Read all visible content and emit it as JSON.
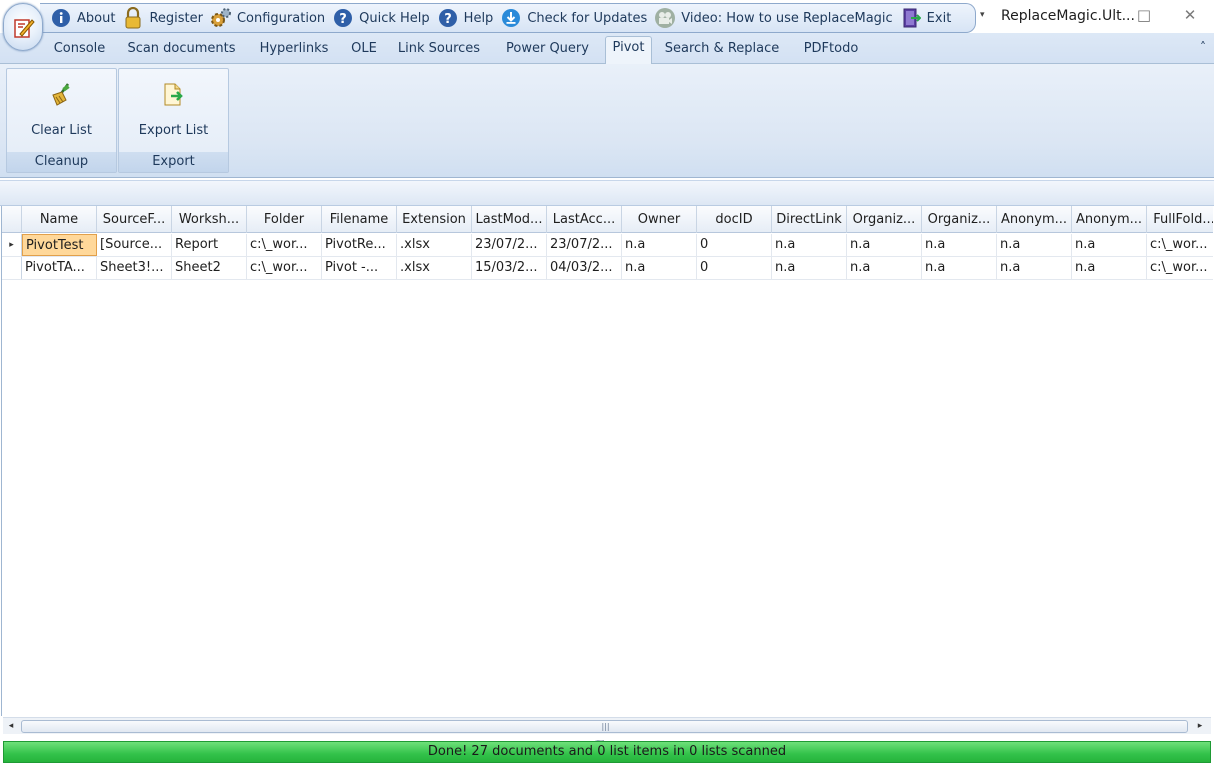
{
  "window": {
    "title": "ReplaceMagic.Ult...",
    "minimize_glyph": "□",
    "close_glyph": "✕"
  },
  "qat": {
    "items": [
      {
        "label": "About",
        "icon": "info-icon"
      },
      {
        "label": "Register",
        "icon": "lock-icon"
      },
      {
        "label": "Configuration",
        "icon": "gears-icon"
      },
      {
        "label": "Quick Help",
        "icon": "question-icon"
      },
      {
        "label": "Help",
        "icon": "question-icon"
      },
      {
        "label": "Check for Updates",
        "icon": "download-icon"
      },
      {
        "label": "Video: How to use ReplaceMagic",
        "icon": "video-icon"
      },
      {
        "label": "Exit",
        "icon": "exit-door-icon"
      }
    ],
    "more_glyph": "▾"
  },
  "tabs": [
    {
      "label": "Console"
    },
    {
      "label": "Scan documents"
    },
    {
      "label": "Hyperlinks"
    },
    {
      "label": "OLE"
    },
    {
      "label": "Link Sources"
    },
    {
      "label": "Power Query"
    },
    {
      "label": "Pivot",
      "active": true
    },
    {
      "label": "Search & Replace"
    },
    {
      "label": "PDFtodo"
    }
  ],
  "collapse_glyph": "˄",
  "ribbon": {
    "groups": [
      {
        "caption": "Cleanup",
        "button": "Clear List",
        "icon": "broom-icon"
      },
      {
        "caption": "Export",
        "button": "Export List",
        "icon": "export-icon"
      }
    ]
  },
  "grid": {
    "columns": [
      "Name",
      "SourceF...",
      "Worksh...",
      "Folder",
      "Filename",
      "Extension",
      "LastMod...",
      "LastAcc...",
      "Owner",
      "docID",
      "DirectLink",
      "Organiz...",
      "Organiz...",
      "Anonym...",
      "Anonym...",
      "FullFold..."
    ],
    "rows": [
      {
        "current": true,
        "cells": [
          "PivotTest",
          "[Source...",
          "Report",
          "c:\\_wor...",
          "PivotRe...",
          ".xlsx",
          "23/07/2...",
          "23/07/2...",
          "n.a",
          "0",
          "n.a",
          "n.a",
          "n.a",
          "n.a",
          "n.a",
          "c:\\_wor..."
        ]
      },
      {
        "current": false,
        "cells": [
          "PivotTA...",
          "Sheet3!...",
          "Sheet2",
          "c:\\_wor...",
          "Pivot -...",
          ".xlsx",
          "15/03/2...",
          "04/03/2...",
          "n.a",
          "0",
          "n.a",
          "n.a",
          "n.a",
          "n.a",
          "n.a",
          "c:\\_wor..."
        ]
      }
    ],
    "row_pointer_glyph": "▸"
  },
  "scrollbar": {
    "left_glyph": "◂",
    "right_glyph": "▸",
    "grip_glyph": "|||"
  },
  "status": {
    "text": "Done! 27 documents and 0 list items in 0 lists scanned",
    "color": "#33c24a"
  }
}
